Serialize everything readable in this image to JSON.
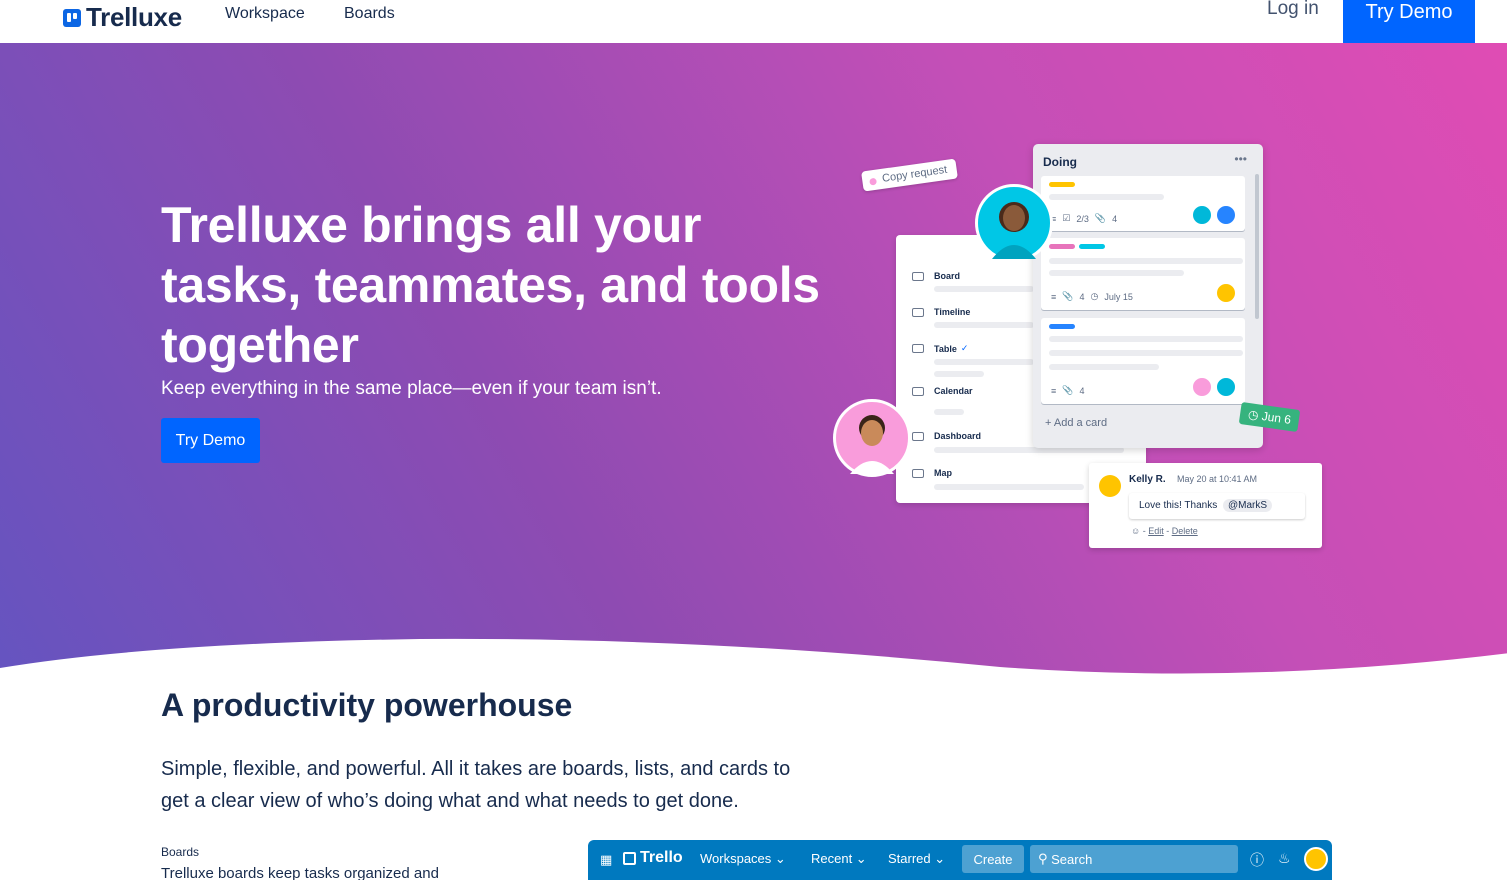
{
  "nav": {
    "brand": "Trelluxe",
    "links": [
      "Workspace",
      "Boards"
    ],
    "login": "Log in",
    "try_demo": "Try Demo"
  },
  "hero": {
    "title": "Trelluxe brings all your tasks, teammates, and tools together",
    "subtitle": "Keep everything in the same place—even if your team isn’t.",
    "cta": "Try Demo"
  },
  "illustration": {
    "copy_request_tag": "Copy request",
    "views": [
      "Board",
      "Timeline",
      "Table",
      "Calendar",
      "Dashboard",
      "Map"
    ],
    "table_check": "✓",
    "list_title": "Doing",
    "list_menu": "•••",
    "card1_checklist": "2/3",
    "card1_attachments": "4",
    "card2_attachments": "4",
    "card2_date": "July 15",
    "card3_attachments": "4",
    "add_card": "+ Add a card",
    "due_tag": "Jun 6",
    "comment": {
      "author": "Kelly R.",
      "time": "May 20 at 10:41 AM",
      "text": "Love this! Thanks",
      "mention": "@MarkS",
      "edit": "Edit",
      "delete": "Delete"
    }
  },
  "section": {
    "title": "A productivity powerhouse",
    "text": "Simple, flexible, and powerful. All it takes are boards, lists, and cards to get a clear view of who’s doing what and what needs to get done.",
    "feature_title": "Boards",
    "feature_text": "Trelluxe boards keep tasks organized and"
  },
  "app_bar": {
    "logo": "Trello",
    "items": [
      "Workspaces ⌄",
      "Recent ⌄",
      "Starred ⌄"
    ],
    "create": "Create",
    "search_placeholder": "Search",
    "icons": [
      "apps-grid-icon",
      "info-icon",
      "bell-icon"
    ]
  },
  "colors": {
    "brand_blue": "#0065ff",
    "gradient_start": "#6554c0",
    "gradient_end": "#e04cb4",
    "text_dark": "#172b4d"
  }
}
